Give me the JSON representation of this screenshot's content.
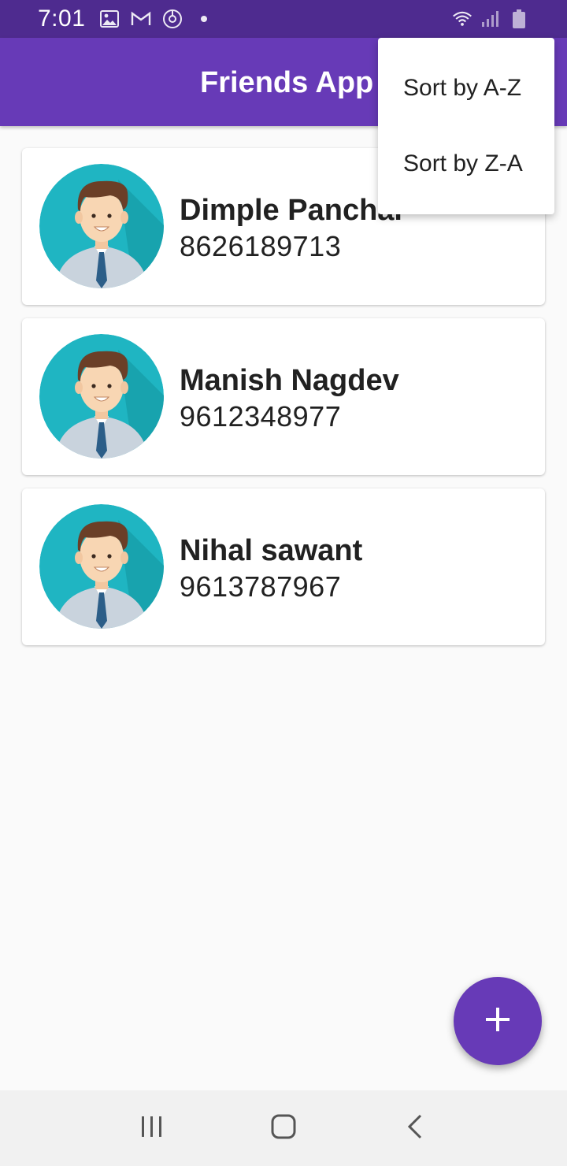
{
  "status_bar": {
    "time": "7:01",
    "left_icons": [
      "image-icon",
      "gmail-icon",
      "sync-icon",
      "dot-icon"
    ],
    "right_icons": [
      "wifi-icon",
      "signal-icon",
      "battery-icon"
    ]
  },
  "app_bar": {
    "title": "Friends App",
    "color": "#673ab7"
  },
  "menu": {
    "items": [
      {
        "label": "Sort by A-Z"
      },
      {
        "label": "Sort by Z-A"
      }
    ]
  },
  "contacts": [
    {
      "name": "Dimple Panchal",
      "phone": "8626189713",
      "avatar": "person-avatar-icon"
    },
    {
      "name": "Manish Nagdev",
      "phone": "9612348977",
      "avatar": "person-avatar-icon"
    },
    {
      "name": "Nihal sawant",
      "phone": "9613787967",
      "avatar": "person-avatar-icon"
    }
  ],
  "fab": {
    "icon": "plus-icon"
  },
  "nav_bar": {
    "icons": [
      "recents-icon",
      "home-icon",
      "back-icon"
    ]
  }
}
